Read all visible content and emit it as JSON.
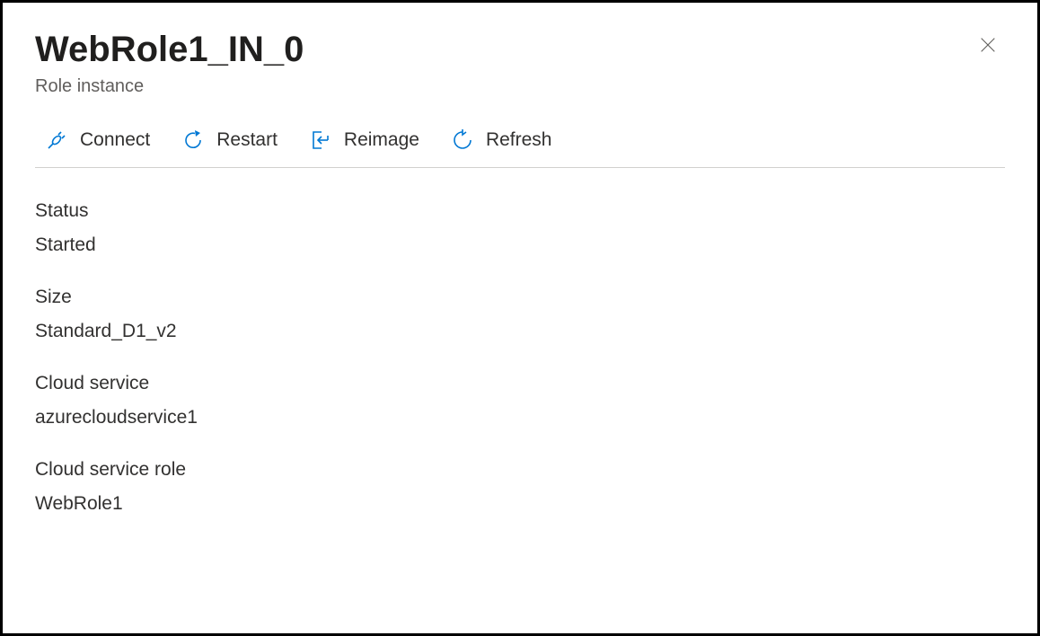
{
  "header": {
    "title": "WebRole1_IN_0",
    "subtitle": "Role instance"
  },
  "toolbar": {
    "connect": "Connect",
    "restart": "Restart",
    "reimage": "Reimage",
    "refresh": "Refresh"
  },
  "properties": {
    "status": {
      "label": "Status",
      "value": "Started"
    },
    "size": {
      "label": "Size",
      "value": "Standard_D1_v2"
    },
    "cloudService": {
      "label": "Cloud service",
      "value": "azurecloudservice1"
    },
    "cloudServiceRole": {
      "label": "Cloud service role",
      "value": "WebRole1"
    }
  }
}
